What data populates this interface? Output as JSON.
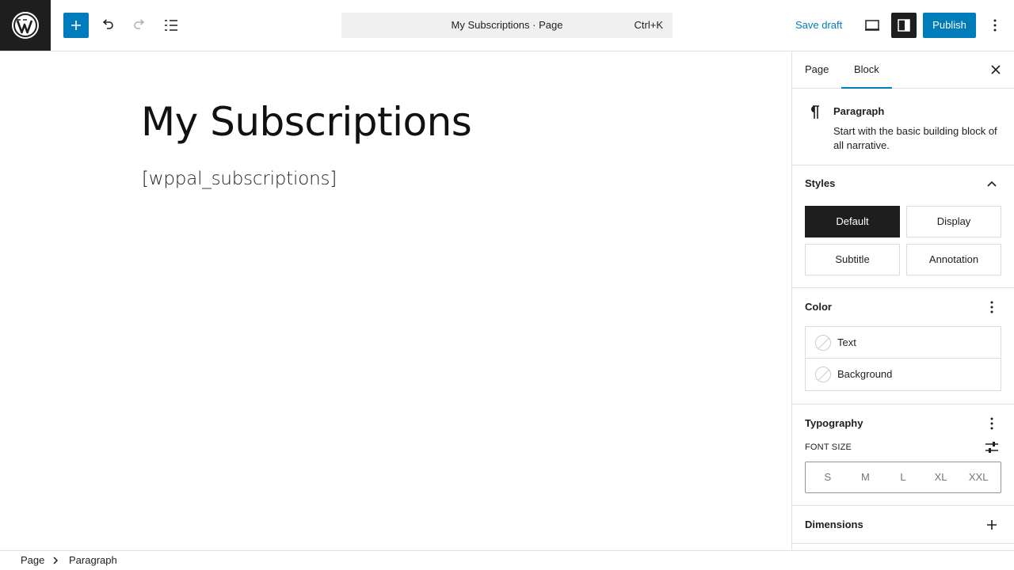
{
  "toolbar": {
    "command_title": "My Subscriptions · Page",
    "command_shortcut": "Ctrl+K",
    "save_draft": "Save draft",
    "publish": "Publish"
  },
  "canvas": {
    "title": "My Subscriptions",
    "paragraph": "[wppal_subscriptions]"
  },
  "sidebar": {
    "tabs": [
      "Page",
      "Block"
    ],
    "block": {
      "name": "Paragraph",
      "description": "Start with the basic building block of all narrative."
    },
    "styles": {
      "title": "Styles",
      "options": [
        "Default",
        "Display",
        "Subtitle",
        "Annotation"
      ],
      "selected": "Default"
    },
    "color": {
      "title": "Color",
      "items": [
        "Text",
        "Background"
      ]
    },
    "typography": {
      "title": "Typography",
      "font_size_label": "FONT SIZE",
      "sizes": [
        "S",
        "M",
        "L",
        "XL",
        "XXL"
      ]
    },
    "dimensions": {
      "title": "Dimensions"
    }
  },
  "breadcrumb": [
    "Page",
    "Paragraph"
  ],
  "colors": {
    "accent": "#007cba",
    "dark": "#1e1e1e"
  }
}
